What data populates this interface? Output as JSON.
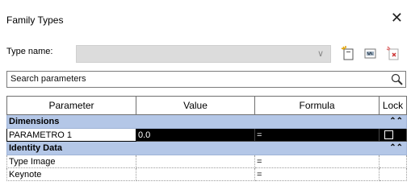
{
  "window": {
    "title": "Family Types"
  },
  "type_name": {
    "label": "Type name:",
    "value": ""
  },
  "search": {
    "placeholder": "Search parameters"
  },
  "table": {
    "headers": {
      "parameter": "Parameter",
      "value": "Value",
      "formula": "Formula",
      "lock": "Lock"
    },
    "groups": [
      {
        "name": "Dimensions",
        "rows": [
          {
            "parameter": "PARAMETRO 1",
            "value": "0.0",
            "formula": "=",
            "lock": false
          }
        ]
      },
      {
        "name": "Identity Data",
        "rows": [
          {
            "parameter": "Type Image",
            "value": "",
            "formula": "="
          },
          {
            "parameter": "Keynote",
            "value": "",
            "formula": "="
          }
        ]
      }
    ]
  },
  "icons": [
    "new-type-icon",
    "rename-type-icon",
    "delete-type-icon",
    "search-icon",
    "close-icon",
    "collapse-icon"
  ],
  "colors": {
    "group_header_bg": "#b4c7e7",
    "selected_row_bg": "#000000"
  }
}
